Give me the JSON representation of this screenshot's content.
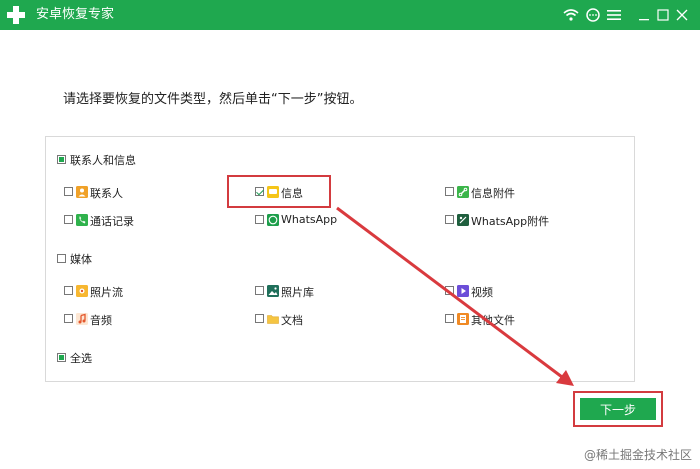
{
  "app": {
    "title": "安卓恢复专家",
    "brand_color": "#1fa84f",
    "window_controls": [
      "wifi-icon",
      "chat-icon",
      "menu-icon",
      "minimize-icon",
      "maximize-icon",
      "close-icon"
    ]
  },
  "instruction": "请选择要恢复的文件类型，然后单击“下一步”按钮。",
  "groups": [
    {
      "label": "联系人和信息",
      "state": "partial",
      "items": [
        {
          "label": "联系人",
          "checked": false,
          "icon": "contacts-icon"
        },
        {
          "label": "信息",
          "checked": true,
          "icon": "messages-icon"
        },
        {
          "label": "信息附件",
          "checked": false,
          "icon": "attachment-icon"
        },
        {
          "label": "通话记录",
          "checked": false,
          "icon": "phone-icon"
        },
        {
          "label": "WhatsApp",
          "checked": false,
          "icon": "whatsapp-icon"
        },
        {
          "label": "WhatsApp附件",
          "checked": false,
          "icon": "whatsapp-attachment-icon"
        }
      ]
    },
    {
      "label": "媒体",
      "state": "unchecked",
      "items": [
        {
          "label": "照片流",
          "checked": false,
          "icon": "photo-stream-icon"
        },
        {
          "label": "照片库",
          "checked": false,
          "icon": "photo-library-icon"
        },
        {
          "label": "视频",
          "checked": false,
          "icon": "video-icon"
        },
        {
          "label": "音频",
          "checked": false,
          "icon": "audio-icon"
        },
        {
          "label": "文档",
          "checked": false,
          "icon": "folder-icon"
        },
        {
          "label": "其他文件",
          "checked": false,
          "icon": "other-files-icon"
        }
      ]
    }
  ],
  "select_all": {
    "label": "全选",
    "state": "partial"
  },
  "next_button": "下一步",
  "watermark": "@稀土掘金技术社区",
  "highlight_color": "#d33b3f"
}
